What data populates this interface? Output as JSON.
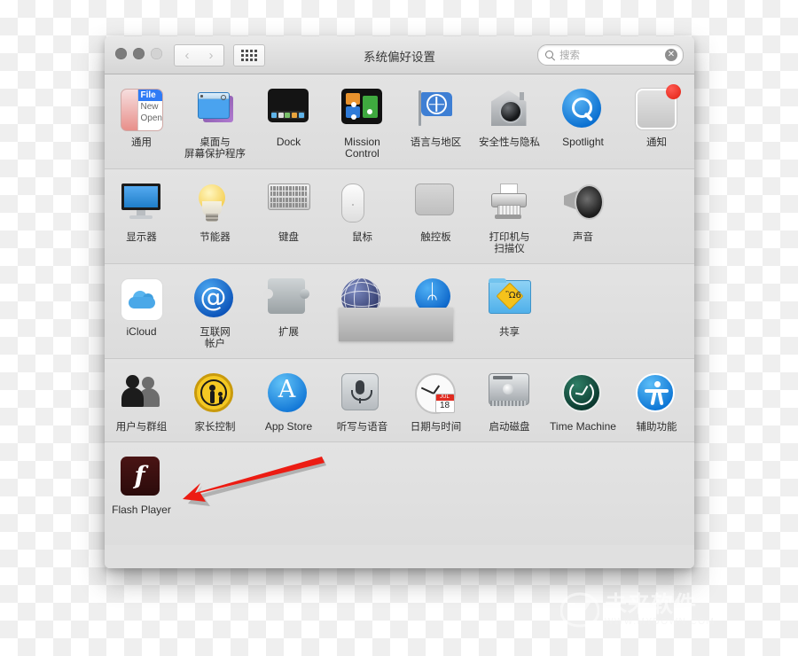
{
  "window": {
    "title": "系统偏好设置",
    "traffic_lights": [
      "close",
      "minimize",
      "zoom"
    ],
    "toolbar": {
      "back_label": "‹",
      "forward_label": "›",
      "grid_label": "show-all"
    },
    "search": {
      "placeholder": "搜索",
      "value": "",
      "clear_label": "✕"
    }
  },
  "rows": [
    {
      "items": [
        {
          "label": "通用",
          "icon": "general-icon",
          "icon_class": "ico-general",
          "latin": false,
          "general": {
            "menu_title": "File",
            "menu_item_1": "New",
            "menu_item_2": "Open"
          }
        },
        {
          "label": "桌面与\n屏幕保护程序",
          "icon": "desktop-screensaver-icon",
          "icon_class": "ico-desktop",
          "latin": false
        },
        {
          "label": "Dock",
          "icon": "dock-icon",
          "icon_class": "ico-dock",
          "latin": true
        },
        {
          "label": "Mission\nControl",
          "icon": "mission-control-icon",
          "icon_class": "ico-mission",
          "latin": true
        },
        {
          "label": "语言与地区",
          "icon": "language-region-icon",
          "icon_class": "ico-flag",
          "latin": false
        },
        {
          "label": "安全性与隐私",
          "icon": "security-privacy-icon",
          "icon_class": "ico-security",
          "latin": false
        },
        {
          "label": "Spotlight",
          "icon": "spotlight-icon",
          "icon_class": "ico-spotlight",
          "latin": true
        },
        {
          "label": "通知",
          "icon": "notifications-icon",
          "icon_class": "ico-notify",
          "latin": false
        }
      ]
    },
    {
      "items": [
        {
          "label": "显示器",
          "icon": "displays-icon",
          "icon_class": "ico-display",
          "latin": false
        },
        {
          "label": "节能器",
          "icon": "energy-saver-icon",
          "icon_class": "ico-energy",
          "latin": false
        },
        {
          "label": "键盘",
          "icon": "keyboard-icon",
          "icon_class": "ico-keyboard",
          "latin": false
        },
        {
          "label": "鼠标",
          "icon": "mouse-icon",
          "icon_class": "ico-mouse",
          "latin": false
        },
        {
          "label": "触控板",
          "icon": "trackpad-icon",
          "icon_class": "ico-trackpad",
          "latin": false
        },
        {
          "label": "打印机与\n扫描仪",
          "icon": "printers-scanners-icon",
          "icon_class": "ico-printer",
          "latin": false
        },
        {
          "label": "声音",
          "icon": "sound-icon",
          "icon_class": "ico-sound",
          "latin": false
        }
      ]
    },
    {
      "items": [
        {
          "label": "iCloud",
          "icon": "icloud-icon",
          "icon_class": "ico-icloud",
          "latin": true
        },
        {
          "label": "互联网\n帐户",
          "icon": "internet-accounts-icon",
          "icon_class": "ico-at",
          "latin": false
        },
        {
          "label": "扩展",
          "icon": "extensions-icon",
          "icon_class": "ico-ext",
          "latin": false
        },
        {
          "label": "",
          "icon": "network-icon",
          "icon_class": "ico-network",
          "latin": false
        },
        {
          "label": "",
          "icon": "bluetooth-icon",
          "icon_class": "ico-bt",
          "latin": false
        },
        {
          "label": "共享",
          "icon": "sharing-icon",
          "icon_class": "ico-sharing",
          "latin": false
        }
      ]
    },
    {
      "items": [
        {
          "label": "用户与群组",
          "icon": "users-groups-icon",
          "icon_class": "ico-users",
          "latin": false
        },
        {
          "label": "家长控制",
          "icon": "parental-controls-icon",
          "icon_class": "ico-parental",
          "latin": false
        },
        {
          "label": "App Store",
          "icon": "app-store-icon",
          "icon_class": "ico-appstore",
          "latin": true
        },
        {
          "label": "听写与语音",
          "icon": "dictation-speech-icon",
          "icon_class": "ico-dictation",
          "latin": false
        },
        {
          "label": "日期与时间",
          "icon": "date-time-icon",
          "icon_class": "ico-datetime",
          "latin": false,
          "calendar": {
            "month": "JUL",
            "day": "18"
          }
        },
        {
          "label": "启动磁盘",
          "icon": "startup-disk-icon",
          "icon_class": "ico-startup",
          "latin": false
        },
        {
          "label": "Time Machine",
          "icon": "time-machine-icon",
          "icon_class": "ico-timemachine",
          "latin": true
        },
        {
          "label": "辅助功能",
          "icon": "accessibility-icon",
          "icon_class": "ico-access",
          "latin": false
        }
      ]
    },
    {
      "last": true,
      "items": [
        {
          "label": "Flash Player",
          "icon": "flash-player-icon",
          "icon_class": "ico-flash",
          "latin": true,
          "flash": {
            "glyph": "f"
          }
        }
      ]
    }
  ],
  "annotation": {
    "arrow_color": "#ec1c13",
    "points_to": "Flash Player"
  },
  "watermark": {
    "main_text": "未来软件",
    "sub_text": "WWW.MYDOWN.COM",
    "color": "#ffffff"
  }
}
